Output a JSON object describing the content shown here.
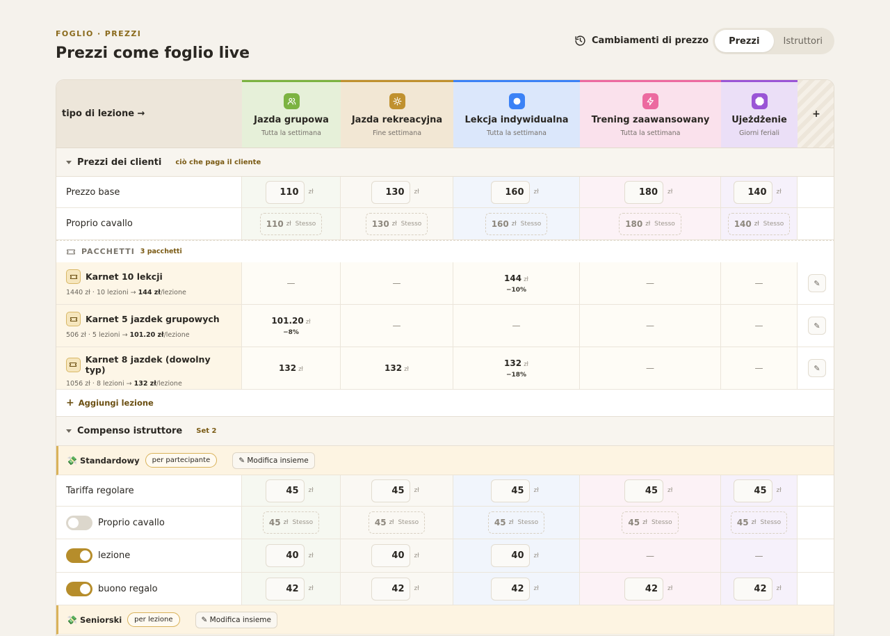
{
  "page": {
    "eyebrow": "FOGLIO · PREZZI",
    "title": "Prezzi come foglio live"
  },
  "toolbar": {
    "history_label": "Cambiamenti di prezzo",
    "tabs": [
      "Prezzi",
      "Istruttori"
    ]
  },
  "corner_label": "tipo di lezione →",
  "add_column": "+",
  "currency": "zł",
  "same_label": "Stesso",
  "empty": "—",
  "columns": [
    {
      "name": "Jazda grupowa",
      "sub": "Tutta la settimana",
      "accent": "#7cb342",
      "bg": "#e6f0d9",
      "cellbg": "#f6f8f1",
      "icon": "users-icon"
    },
    {
      "name": "Jazda rekreacyjna",
      "sub": "Fine settimana",
      "accent": "#c0912f",
      "bg": "#f2e7d4",
      "cellbg": "#faf8f3",
      "icon": "sun-icon"
    },
    {
      "name": "Lekcja indywidualna",
      "sub": "Tutta la settimana",
      "accent": "#3b82f6",
      "bg": "#dbe7fb",
      "cellbg": "#f1f5fc",
      "icon": "circle-icon"
    },
    {
      "name": "Trening zaawansowany",
      "sub": "Tutta la settimana",
      "accent": "#ec6aa0",
      "bg": "#fae1ec",
      "cellbg": "#fcf2f6",
      "icon": "bolt-icon"
    },
    {
      "name": "Ujeżdżenie",
      "sub": "Giorni feriali",
      "accent": "#9a55d6",
      "bg": "#ebdff7",
      "cellbg": "#f6f1fb",
      "icon": "octagon-icon"
    }
  ],
  "client": {
    "title": "Prezzi dei clienti",
    "subtitle": "ciò che paga il cliente",
    "base_label": "Prezzo base",
    "base_prices": [
      "110",
      "130",
      "160",
      "180",
      "140"
    ],
    "own_label": "Proprio cavallo",
    "own_prices": [
      "110",
      "130",
      "160",
      "180",
      "140"
    ]
  },
  "packages": {
    "title": "PACCHETTI",
    "count": "3 pacchetti",
    "items": [
      {
        "name": "Karnet 10 lekcji",
        "desc": "1440 zł · 10 lezioni → ",
        "per": "144 zł",
        "per_suffix": "/lezione",
        "cells": [
          null,
          null,
          {
            "v": "144",
            "d": "−10%"
          },
          null,
          null
        ]
      },
      {
        "name": "Karnet 5 jazdek grupowych",
        "desc": "506 zł · 5 lezioni → ",
        "per": "101.20 zł",
        "per_suffix": "/lezione",
        "cells": [
          {
            "v": "101.20",
            "d": "−8%"
          },
          null,
          null,
          null,
          null
        ]
      },
      {
        "name": "Karnet 8 jazdek (dowolny typ)",
        "desc": "1056 zł · 8 lezioni → ",
        "per": "132 zł",
        "per_suffix": "/lezione",
        "cells": [
          {
            "v": "132",
            "d": ""
          },
          {
            "v": "132",
            "d": ""
          },
          {
            "v": "132",
            "d": "−18%"
          },
          null,
          null
        ]
      }
    ]
  },
  "add_lesson": "Aggiungi lezione",
  "instructor": {
    "title": "Compenso istruttore",
    "subtitle": "Set 2",
    "groups": [
      {
        "name": "Standardowy",
        "pill": "per partecipante",
        "edit": "✎ Modifica insieme"
      },
      {
        "name": "Seniorski",
        "pill": "per lezione",
        "edit": "✎ Modifica insieme"
      }
    ],
    "regular_label": "Tariffa regolare",
    "regular": [
      "45",
      "45",
      "45",
      "45",
      "45"
    ],
    "own_label": "Proprio cavallo",
    "own": [
      "45",
      "45",
      "45",
      "45",
      "45"
    ],
    "lesson_label": "lezione",
    "lesson": [
      "40",
      "40",
      "40",
      null,
      null
    ],
    "gift_label": "buono regalo",
    "gift": [
      "42",
      "42",
      "42",
      "42",
      "42"
    ]
  }
}
